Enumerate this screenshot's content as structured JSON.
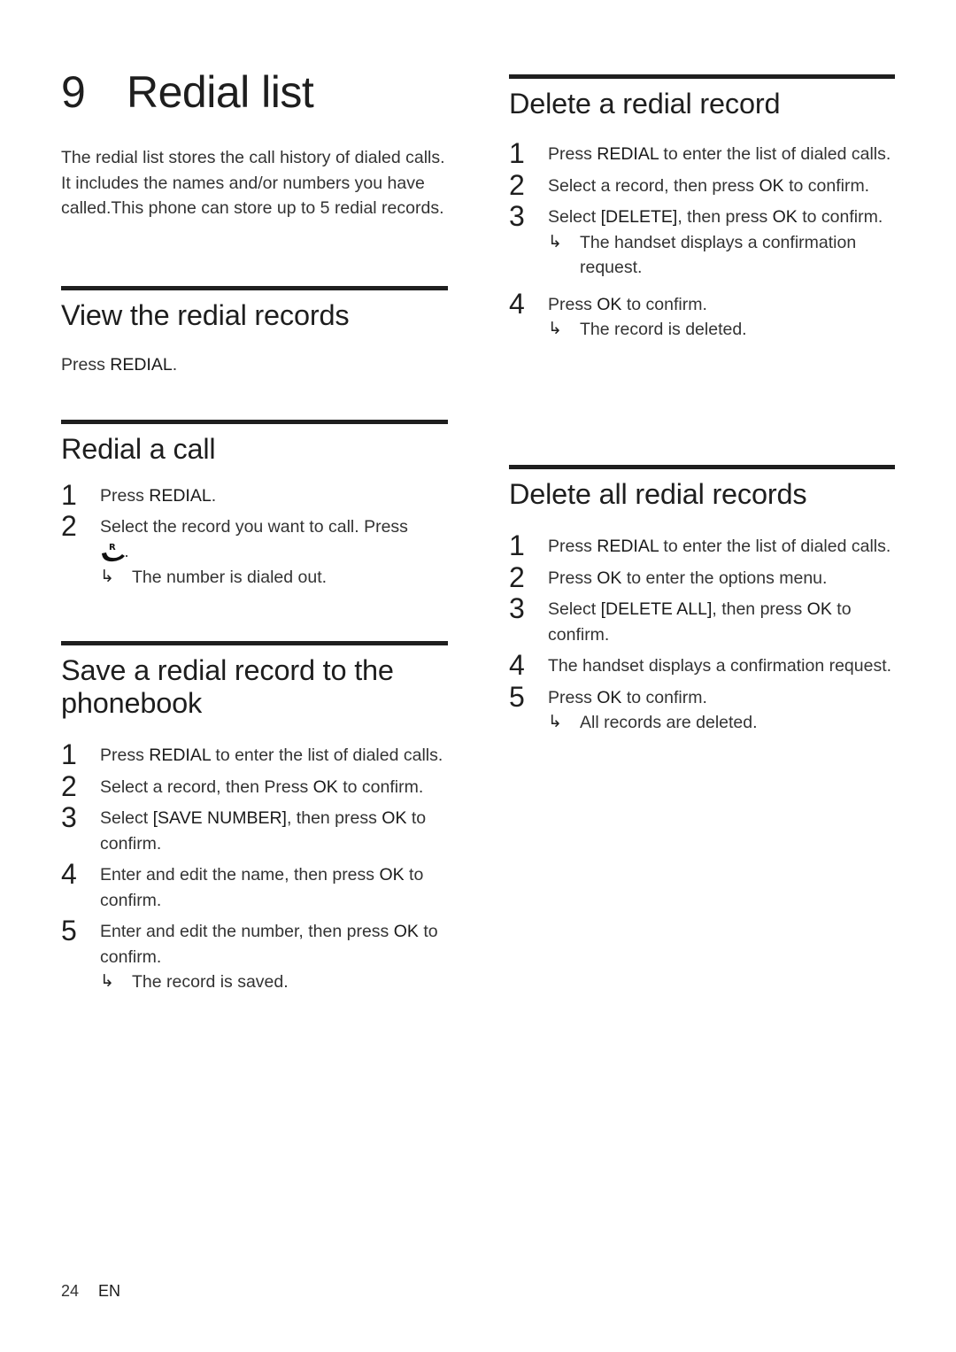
{
  "chapter": {
    "number": "9",
    "title": "Redial list",
    "intro": "The redial list stores the call history of dialed calls. It includes the names and/or numbers you have called.This phone can store up to 5 redial records."
  },
  "view": {
    "heading": "View the redial records",
    "text_pre": "Press ",
    "text_key": "REDIAL",
    "text_post": "."
  },
  "redial_call": {
    "heading": "Redial a call",
    "steps": [
      {
        "num": "1",
        "pre": "Press ",
        "key": "REDIAL",
        "post": "."
      },
      {
        "num": "2",
        "pre": "Select the record you want to call. Press",
        "icon": "redial-phone-icon",
        "result": "The number is dialed out."
      }
    ]
  },
  "save_record": {
    "heading": "Save a redial record to the phonebook",
    "steps": [
      {
        "num": "1",
        "pre": "Press ",
        "key": "REDIAL",
        "post": " to enter the list of dialed calls."
      },
      {
        "num": "2",
        "pre": "Select a record, then Press ",
        "key": "OK",
        "post": " to confirm."
      },
      {
        "num": "3",
        "pre": "Select ",
        "key": "[SAVE NUMBER]",
        "mid": ", then press ",
        "key2": "OK",
        "post": " to confirm."
      },
      {
        "num": "4",
        "pre": "Enter and edit the name, then press ",
        "key": "OK",
        "post": " to confirm."
      },
      {
        "num": "5",
        "pre": "Enter and edit the number, then press ",
        "key": "OK",
        "post": " to confirm.",
        "result": "The record is saved."
      }
    ]
  },
  "delete_record": {
    "heading": "Delete a redial record",
    "steps": [
      {
        "num": "1",
        "pre": "Press ",
        "key": "REDIAL",
        "post": " to enter the list of dialed calls."
      },
      {
        "num": "2",
        "pre": "Select a record, then press ",
        "key": "OK",
        "post": " to confirm."
      },
      {
        "num": "3",
        "pre": "Select ",
        "key": "[DELETE]",
        "mid": ", then press ",
        "key2": "OK",
        "post": " to confirm.",
        "result": "The handset displays a confirmation request."
      },
      {
        "num": "4",
        "pre": "Press ",
        "key": "OK",
        "post": " to confirm.",
        "result": "The record is deleted."
      }
    ]
  },
  "delete_all": {
    "heading": "Delete all redial records",
    "steps": [
      {
        "num": "1",
        "pre": "Press ",
        "key": "REDIAL",
        "post": " to enter the list of dialed calls."
      },
      {
        "num": "2",
        "pre": "Press ",
        "key": "OK",
        "post": " to enter the options menu."
      },
      {
        "num": "3",
        "pre": "Select ",
        "key": "[DELETE ALL]",
        "mid": ", then press ",
        "key2": "OK",
        "post": " to confirm."
      },
      {
        "num": "4",
        "pre": "The handset displays a confirmation request."
      },
      {
        "num": "5",
        "pre": "Press ",
        "key": "OK",
        "post": " to confirm.",
        "result": "All records are deleted."
      }
    ]
  },
  "result_arrow": "↳",
  "footer": {
    "page": "24",
    "lang": "EN"
  }
}
